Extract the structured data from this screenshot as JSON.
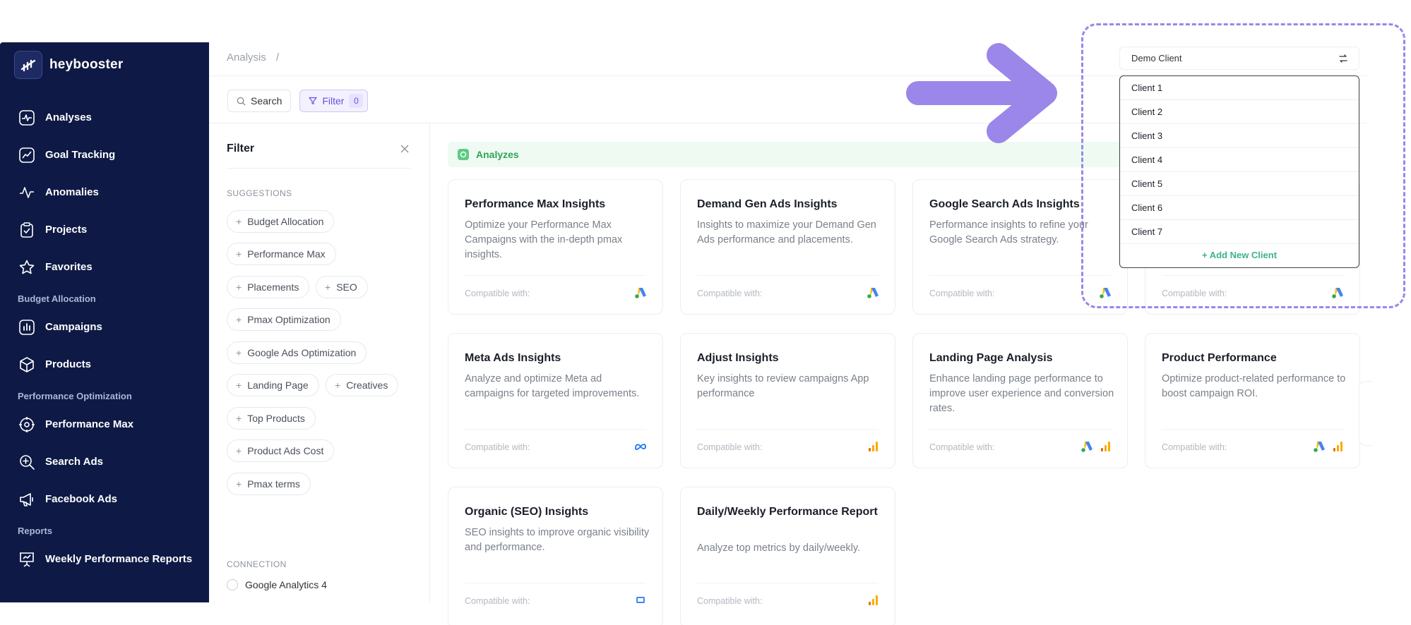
{
  "brand": {
    "name": "heybooster"
  },
  "sidebar": {
    "items_top": [
      {
        "label": "Analyses",
        "icon": "pulse-icon"
      },
      {
        "label": "Goal Tracking",
        "icon": "trend-icon"
      },
      {
        "label": "Anomalies",
        "icon": "anomaly-icon"
      },
      {
        "label": "Projects",
        "icon": "clipboard-icon"
      },
      {
        "label": "Favorites",
        "icon": "star-icon"
      }
    ],
    "section_budget": "Budget Allocation",
    "items_budget": [
      {
        "label": "Campaigns",
        "icon": "bar-chart-icon"
      },
      {
        "label": "Products",
        "icon": "box-icon"
      }
    ],
    "section_perf": "Performance Optimization",
    "items_perf": [
      {
        "label": "Performance Max",
        "icon": "target-icon"
      },
      {
        "label": "Search Ads",
        "icon": "search-plus-icon"
      },
      {
        "label": "Facebook Ads",
        "icon": "megaphone-icon"
      }
    ],
    "section_reports": "Reports",
    "items_reports": [
      {
        "label": "Weekly Performance Reports",
        "icon": "presentation-icon"
      }
    ]
  },
  "breadcrumb": {
    "root": "Analysis",
    "sep": "/"
  },
  "toolbar": {
    "search_label": "Search",
    "filter_label": "Filter",
    "filter_count": "0"
  },
  "filter_panel": {
    "title": "Filter",
    "suggestions_label": "SUGGESTIONS",
    "chips": [
      "Budget Allocation",
      "Performance Max",
      "Placements",
      "SEO",
      "Pmax Optimization",
      "Google Ads Optimization",
      "Landing Page",
      "Creatives",
      "Top Products",
      "Product Ads Cost",
      "Pmax terms"
    ],
    "connection_label": "CONNECTION",
    "connections": [
      "Google Analytics 4"
    ]
  },
  "section": {
    "label": "Analyzes"
  },
  "compatible_label": "Compatible with:",
  "cards": [
    {
      "title": "Performance Max Insights",
      "desc": "Optimize your Performance Max Campaigns with the in-depth pmax insights.",
      "icons": [
        "google-ads-icon"
      ]
    },
    {
      "title": "Demand Gen Ads Insights",
      "desc": "Insights to maximize your Demand Gen Ads performance and placements.",
      "icons": [
        "google-ads-icon"
      ]
    },
    {
      "title": "Google Search Ads Insights",
      "desc": "Performance insights to refine your Google Search Ads strategy.",
      "icons": [
        "google-ads-icon"
      ]
    },
    {
      "title": "",
      "desc": "",
      "icons": [
        "google-ads-icon"
      ]
    },
    {
      "title": "Meta Ads Insights",
      "desc": "Analyze and optimize Meta ad campaigns for targeted improvements.",
      "icons": [
        "meta-icon"
      ]
    },
    {
      "title": "Adjust Insights",
      "desc": "Key insights to review campaigns App performance",
      "icons": [
        "analytics-bars-icon"
      ]
    },
    {
      "title": "Landing Page Analysis",
      "desc": "Enhance landing page performance to improve user experience and conversion rates.",
      "icons": [
        "google-ads-icon",
        "analytics-bars-icon"
      ]
    },
    {
      "title": "Product Performance",
      "desc": "Optimize product-related performance to boost campaign ROI.",
      "icons": [
        "google-ads-icon",
        "analytics-bars-icon"
      ]
    },
    {
      "title": "Organic (SEO) Insights",
      "desc": "SEO insights to improve organic visibility and performance.",
      "icons": [
        "search-console-icon"
      ]
    },
    {
      "title": "Daily/Weekly Performance Report",
      "desc": "Analyze top metrics by daily/weekly.",
      "icons": [
        "analytics-bars-icon"
      ]
    }
  ],
  "client_select": {
    "value": "Demo Client",
    "options": [
      "Client 1",
      "Client 2",
      "Client 3",
      "Client 4",
      "Client 5",
      "Client 6",
      "Client 7"
    ],
    "add_label": "+ Add New Client"
  },
  "colors": {
    "sidebar_bg": "#0e1a45",
    "accent_purple": "#6a4fe0",
    "highlight": "#9b86ea",
    "green": "#2fa35a"
  }
}
